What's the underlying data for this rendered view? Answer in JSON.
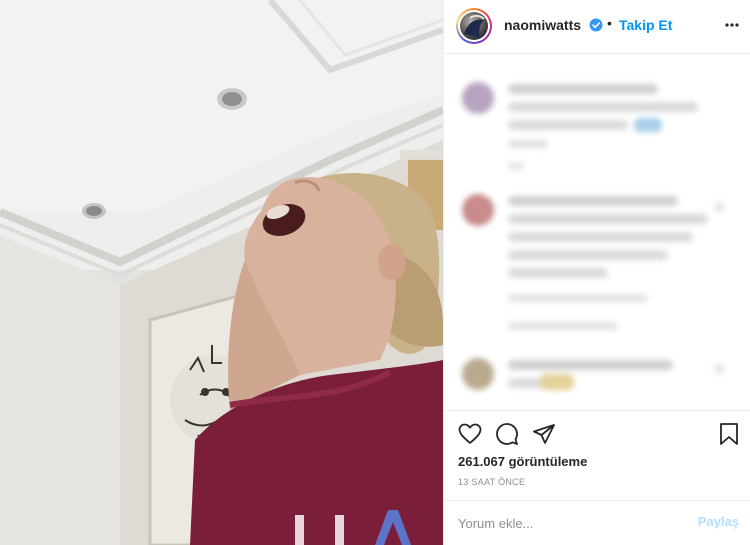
{
  "post": {
    "username": "naomiwatts",
    "separator": "•",
    "follow_label": "Takip Et",
    "views_text": "261.067 görüntüleme",
    "time_text": "13 SAAT ÖNCE"
  },
  "comment_box": {
    "placeholder": "Yorum ekle...",
    "share_label": "Paylaş"
  },
  "icons": {
    "verified": "verified-badge-icon",
    "more": "more-options-icon",
    "like": "heart-icon",
    "comment": "comment-icon",
    "share": "paper-plane-icon",
    "save": "bookmark-icon"
  },
  "colors": {
    "accent": "#0095f6",
    "text": "#262626",
    "muted": "#8e8e8e",
    "share_disabled": "#b2dffc",
    "sweater": "#7a1e3a"
  }
}
